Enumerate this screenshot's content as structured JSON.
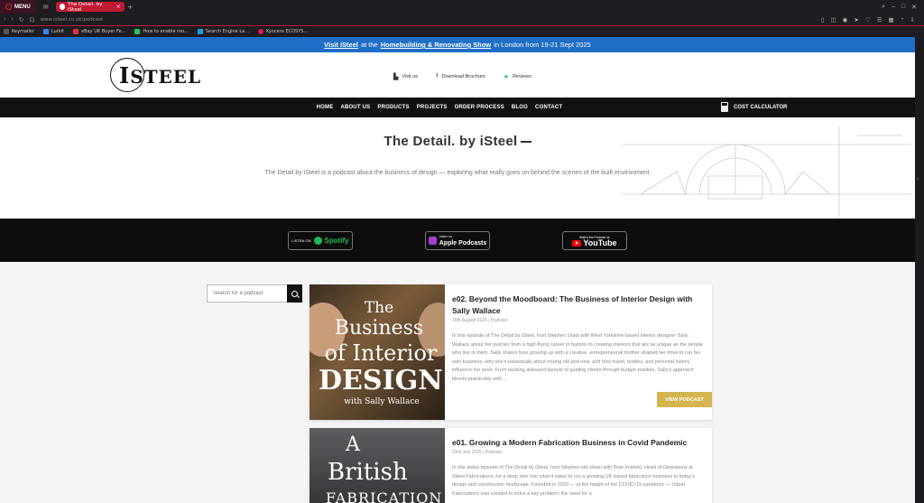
{
  "browser": {
    "menu_label": "MENU",
    "tab_title": "The Detail. by iSteel",
    "url": "www.isteel.co.uk/podcast",
    "bookmarks": [
      "Keymailer",
      "Lurkit",
      "eBay UK Buyer Fe...",
      "How to enable roo...",
      "Search Engine La...",
      "Kyocera ECOSYS..."
    ],
    "accent": "#c11a33"
  },
  "announcement": {
    "link": "Visit iSteel",
    "mid": "at the",
    "event": "Homebuilding & Renovating Show",
    "tail": "in London from 19-21 Sept 2025",
    "bg": "#1f6fc6"
  },
  "header": {
    "logo": "STEEL",
    "links": {
      "visit": "Visit us",
      "brochure": "Download Brochure",
      "reviews": "Reviews"
    }
  },
  "nav": {
    "items": [
      "HOME",
      "ABOUT US",
      "PRODUCTS",
      "PROJECTS",
      "ORDER PROCESS",
      "BLOG",
      "CONTACT"
    ],
    "calculator": "COST CALCULATOR"
  },
  "hero": {
    "title": "The Detail. by iSteel",
    "description": "The Detail by iSteel is a podcast about the business of design — exploring what really goes on behind the scenes of the built environment."
  },
  "platforms": {
    "spotify": {
      "pre": "LISTEN ON",
      "name": "Spotify"
    },
    "apple": {
      "pre": "Listen on",
      "name": "Apple Podcasts"
    },
    "youtube": {
      "pre": "Watch the Podcast on",
      "name": "YouTube"
    }
  },
  "search": {
    "placeholder": "Search for a podcast"
  },
  "episodes": [
    {
      "title": "e02. Beyond the Moodboard: The Business of Interior Design with Sally Wallace",
      "meta": "16th August 2025 | Podcast",
      "excerpt": "In this episode of The Detail by iSteel, host Stephen chats with West Yorkshire-based interior designer Sally Wallace about her journey from a high-flying career in fashion to creating interiors that are as unique as the people who live in them. Sally shares how growing up with a creative, entrepreneurial mother shaped her drive to run her own business, why she's passionate about mixing old and new, and how travel, textiles, and personal history influence her work. From tackling awkward layouts to guiding clients through budget realities, Sally's approach blends practicality with ...",
      "button": "VIEW PODCAST",
      "thumb": [
        "The",
        "Business",
        "of Interior",
        "DESIGN",
        "with Sally Wallace"
      ]
    },
    {
      "title": "e01. Growing a Modern Fabrication Business in Covid Pandemic",
      "meta": "23rd July 2025 | Podcast",
      "excerpt": "In this debut episode of The Detail by iSteel, host Stephen sits down with Pete Imielski, Head of Operations at iSteel Fabrications, for a deep dive into what it takes to run a growing UK-based fabrication business in today's design and construction landscape. Founded in 2020 — at the height of the COVID-19 pandemic — iSteel Fabrications was created to solve a key problem: the need for a",
      "thumb": [
        "A",
        "British",
        "FABRICATION"
      ]
    }
  ],
  "colors": {
    "gold": "#d4b44f",
    "nav": "#111111"
  }
}
